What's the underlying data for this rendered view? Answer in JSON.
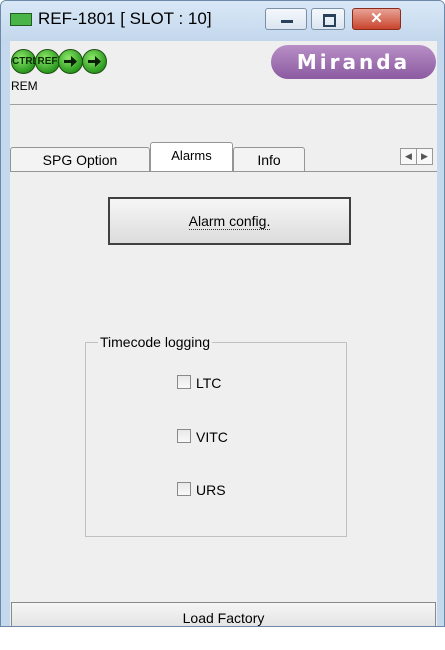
{
  "window": {
    "title": "REF-1801 [ SLOT : 10]",
    "close_symbol": "✕"
  },
  "status_bar": {
    "leds": [
      {
        "label": "CTRL",
        "color": "#3aa82a"
      },
      {
        "label": "REF",
        "color": "#3aa82a"
      },
      {
        "label": "",
        "color": "#3aa82a",
        "icon": "arrow-right-icon"
      },
      {
        "label": "",
        "color": "#3aa82a",
        "icon": "arrow-right-icon"
      }
    ],
    "remote_label": "REM",
    "logo_text": "Miranda"
  },
  "tabs": [
    {
      "label": "SPG Option",
      "active": false
    },
    {
      "label": "Alarms",
      "active": true
    },
    {
      "label": "Info",
      "active": false
    }
  ],
  "alarms_panel": {
    "alarm_config_label": "Alarm config.",
    "timecode_group": {
      "title": "Timecode logging",
      "options": [
        {
          "label": "LTC",
          "checked": false
        },
        {
          "label": "VITC",
          "checked": false
        },
        {
          "label": "URS",
          "checked": false
        }
      ]
    }
  },
  "footer": {
    "load_factory_label": "Load Factory"
  }
}
